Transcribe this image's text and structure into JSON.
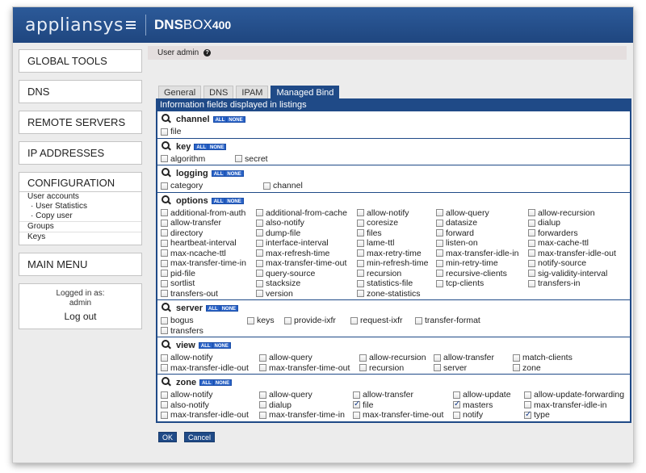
{
  "header": {
    "brand": "appliansys",
    "product_bold": "DNS",
    "product_rest": "BOX",
    "product_version": "400"
  },
  "sidebar": {
    "global_tools": "GLOBAL TOOLS",
    "dns": "DNS",
    "remote_servers": "REMOTE SERVERS",
    "ip_addresses": "IP ADDRESSES",
    "configuration": "CONFIGURATION",
    "config_items": [
      "User accounts",
      "· User Statistics",
      "· Copy user",
      "Groups",
      "Keys"
    ],
    "main_menu": "MAIN MENU",
    "logged_in_label": "Logged in as:",
    "user": "admin",
    "logout": "Log out"
  },
  "userbar": {
    "title": "User admin"
  },
  "tabs": [
    {
      "label": "General",
      "active": false
    },
    {
      "label": "DNS",
      "active": false
    },
    {
      "label": "IPAM",
      "active": false
    },
    {
      "label": "Managed Bind",
      "active": true
    }
  ],
  "panel": {
    "title": "Information fields displayed in listings",
    "all_label": "ALL",
    "none_label": "NONE",
    "sections": [
      {
        "name": "channel",
        "columns": 5,
        "fields": [
          {
            "label": "file",
            "checked": false
          }
        ]
      },
      {
        "name": "key",
        "columns": 5,
        "fields": [
          {
            "label": "algorithm",
            "checked": false
          },
          {
            "label": "secret",
            "checked": false
          }
        ]
      },
      {
        "name": "logging",
        "columns": 5,
        "fields": [
          {
            "label": "category",
            "checked": false
          },
          {
            "label": "channel",
            "checked": false
          }
        ]
      },
      {
        "name": "options",
        "columns": 5,
        "fields": [
          {
            "label": "additional-from-auth",
            "checked": false
          },
          {
            "label": "additional-from-cache",
            "checked": false
          },
          {
            "label": "allow-notify",
            "checked": false
          },
          {
            "label": "allow-query",
            "checked": false
          },
          {
            "label": "allow-recursion",
            "checked": false
          },
          {
            "label": "allow-transfer",
            "checked": false
          },
          {
            "label": "also-notify",
            "checked": false
          },
          {
            "label": "coresize",
            "checked": false
          },
          {
            "label": "datasize",
            "checked": false
          },
          {
            "label": "dialup",
            "checked": false
          },
          {
            "label": "directory",
            "checked": false
          },
          {
            "label": "dump-file",
            "checked": false
          },
          {
            "label": "files",
            "checked": false
          },
          {
            "label": "forward",
            "checked": false
          },
          {
            "label": "forwarders",
            "checked": false
          },
          {
            "label": "heartbeat-interval",
            "checked": false
          },
          {
            "label": "interface-interval",
            "checked": false
          },
          {
            "label": "lame-ttl",
            "checked": false
          },
          {
            "label": "listen-on",
            "checked": false
          },
          {
            "label": "max-cache-ttl",
            "checked": false
          },
          {
            "label": "max-ncache-ttl",
            "checked": false
          },
          {
            "label": "max-refresh-time",
            "checked": false
          },
          {
            "label": "max-retry-time",
            "checked": false
          },
          {
            "label": "max-transfer-idle-in",
            "checked": false
          },
          {
            "label": "max-transfer-idle-out",
            "checked": false
          },
          {
            "label": "max-transfer-time-in",
            "checked": false
          },
          {
            "label": "max-transfer-time-out",
            "checked": false
          },
          {
            "label": "min-refresh-time",
            "checked": false
          },
          {
            "label": "min-retry-time",
            "checked": false
          },
          {
            "label": "notify-source",
            "checked": false
          },
          {
            "label": "pid-file",
            "checked": false
          },
          {
            "label": "query-source",
            "checked": false
          },
          {
            "label": "recursion",
            "checked": false
          },
          {
            "label": "recursive-clients",
            "checked": false
          },
          {
            "label": "sig-validity-interval",
            "checked": false
          },
          {
            "label": "sortlist",
            "checked": false
          },
          {
            "label": "stacksize",
            "checked": false
          },
          {
            "label": "statistics-file",
            "checked": false
          },
          {
            "label": "tcp-clients",
            "checked": false
          },
          {
            "label": "transfers-in",
            "checked": false
          },
          {
            "label": "transfers-out",
            "checked": false
          },
          {
            "label": "version",
            "checked": false
          },
          {
            "label": "zone-statistics",
            "checked": false
          }
        ]
      },
      {
        "name": "server",
        "columns": 5,
        "fields": [
          {
            "label": "bogus",
            "checked": false
          },
          {
            "label": "keys",
            "checked": false
          },
          {
            "label": "provide-ixfr",
            "checked": false
          },
          {
            "label": "request-ixfr",
            "checked": false
          },
          {
            "label": "transfer-format",
            "checked": false
          },
          {
            "label": "transfers",
            "checked": false
          }
        ]
      },
      {
        "name": "view",
        "columns": 5,
        "fields": [
          {
            "label": "allow-notify",
            "checked": false
          },
          {
            "label": "allow-query",
            "checked": false
          },
          {
            "label": "allow-recursion",
            "checked": false
          },
          {
            "label": "allow-transfer",
            "checked": false
          },
          {
            "label": "match-clients",
            "checked": false
          },
          {
            "label": "max-transfer-idle-out",
            "checked": false
          },
          {
            "label": "max-transfer-time-out",
            "checked": false
          },
          {
            "label": "recursion",
            "checked": false
          },
          {
            "label": "server",
            "checked": false
          },
          {
            "label": "zone",
            "checked": false
          }
        ]
      },
      {
        "name": "zone",
        "columns": 5,
        "fields": [
          {
            "label": "allow-notify",
            "checked": false
          },
          {
            "label": "allow-query",
            "checked": false
          },
          {
            "label": "allow-transfer",
            "checked": false
          },
          {
            "label": "allow-update",
            "checked": false
          },
          {
            "label": "allow-update-forwarding",
            "checked": false
          },
          {
            "label": "also-notify",
            "checked": false
          },
          {
            "label": "dialup",
            "checked": false
          },
          {
            "label": "file",
            "checked": true
          },
          {
            "label": "masters",
            "checked": true
          },
          {
            "label": "max-transfer-idle-in",
            "checked": false
          },
          {
            "label": "max-transfer-idle-out",
            "checked": false
          },
          {
            "label": "max-transfer-time-in",
            "checked": false
          },
          {
            "label": "max-transfer-time-out",
            "checked": false
          },
          {
            "label": "notify",
            "checked": false
          },
          {
            "label": "type",
            "checked": true
          }
        ]
      }
    ]
  },
  "buttons": {
    "ok": "OK",
    "cancel": "Cancel"
  },
  "colors": {
    "header": "#1f467f",
    "accent": "#1f4a87",
    "allnone": "#2a63c7"
  },
  "icons": [
    "help-icon",
    "magnifier-icon"
  ]
}
